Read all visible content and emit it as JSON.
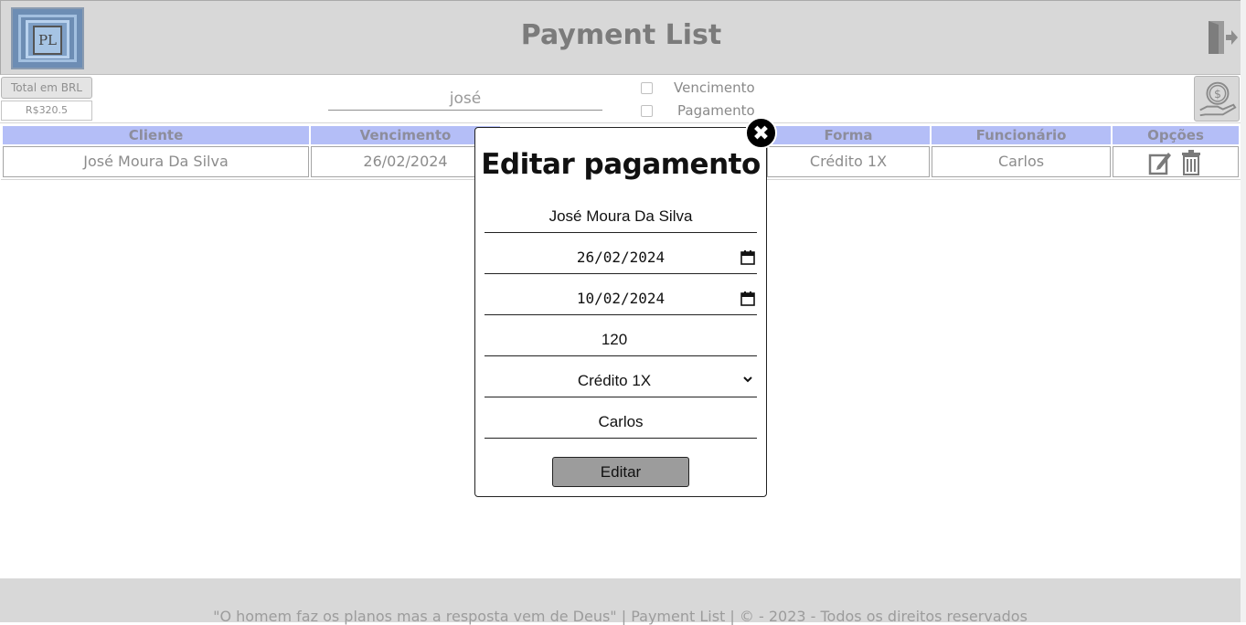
{
  "header": {
    "logo_text": "PL",
    "title": "Payment List"
  },
  "toolbar": {
    "total_label": "Total em BRL",
    "total_value": "R$320.5",
    "search_value": "josé",
    "filters": [
      {
        "label": "Vencimento",
        "checked": false
      },
      {
        "label": "Pagamento",
        "checked": false
      }
    ]
  },
  "table": {
    "headers": [
      "Cliente",
      "Vencimento",
      "Forma",
      "Funcionário",
      "Opções"
    ],
    "rows": [
      {
        "cliente": "José Moura Da Silva",
        "vencimento": "26/02/2024",
        "forma": "Crédito 1X",
        "funcionario": "Carlos"
      }
    ]
  },
  "modal": {
    "title": "Editar pagamento",
    "close_symbol": "✖",
    "fields": {
      "cliente": "José Moura Da Silva",
      "vencimento": "26/02/2024",
      "pagamento": "10/02/2024",
      "valor": "120",
      "forma": "Crédito 1X",
      "funcionario": "Carlos"
    },
    "submit_label": "Editar"
  },
  "footer": {
    "text": "\"O homem faz os planos mas a resposta vem de Deus\" | Payment List | © - 2023 - Todos os direitos reservados"
  },
  "colors": {
    "header_bg": "#d8d8d8",
    "table_header_bg": "#b4bef7",
    "button_gray": "#9c9c9c"
  },
  "icons": [
    "logo-icon",
    "exit-door-icon",
    "money-hand-icon",
    "edit-icon",
    "trash-icon",
    "calendar-icon",
    "chevron-down-icon",
    "close-icon"
  ]
}
